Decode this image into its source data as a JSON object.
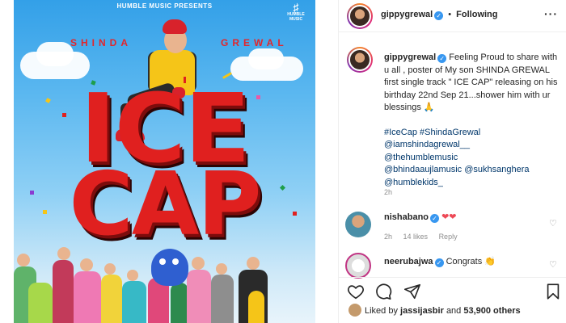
{
  "poster": {
    "presents_text": "HUMBLE MUSIC PRESENTS",
    "label_logo_text": "HUMBLE MUSIC",
    "artist_first": "SHINDA",
    "artist_last": "GREWAL",
    "title_line1": "ICE",
    "title_line2": "CAP"
  },
  "header": {
    "username": "gippygrewal",
    "follow_state": "Following",
    "separator": "•",
    "more_glyph": "···"
  },
  "post": {
    "author": "gippygrewal",
    "caption": "Feeling Proud to share with u all , poster of My son SHINDA GREWAL first single track \" ICE CAP\" releasing on his birthday 22nd Sep 21...shower him with ur blessings 🙏",
    "tags": [
      "#IceCap #ShindaGrewal",
      "@iamshindagrewal__",
      "@thehumblemusic",
      "@bhindaaujlamusic @sukhsanghera",
      "@humblekids_"
    ],
    "time": "2h"
  },
  "comments": [
    {
      "username": "nishabano",
      "text": "❤❤",
      "time": "2h",
      "likes": "14 likes",
      "reply": "Reply"
    },
    {
      "username": "neerubajwa",
      "text": "Congrats 👏",
      "time": "",
      "likes": "",
      "reply": ""
    }
  ],
  "footer": {
    "liked_by_prefix": "Liked by",
    "liked_by_user": "jassijasbir",
    "liked_by_and": "and",
    "liked_by_count": "53,900 others"
  },
  "colors": {
    "verified": "#3897f0",
    "link": "#00376b",
    "heart": "#ed4956",
    "title_red": "#e0201f"
  }
}
